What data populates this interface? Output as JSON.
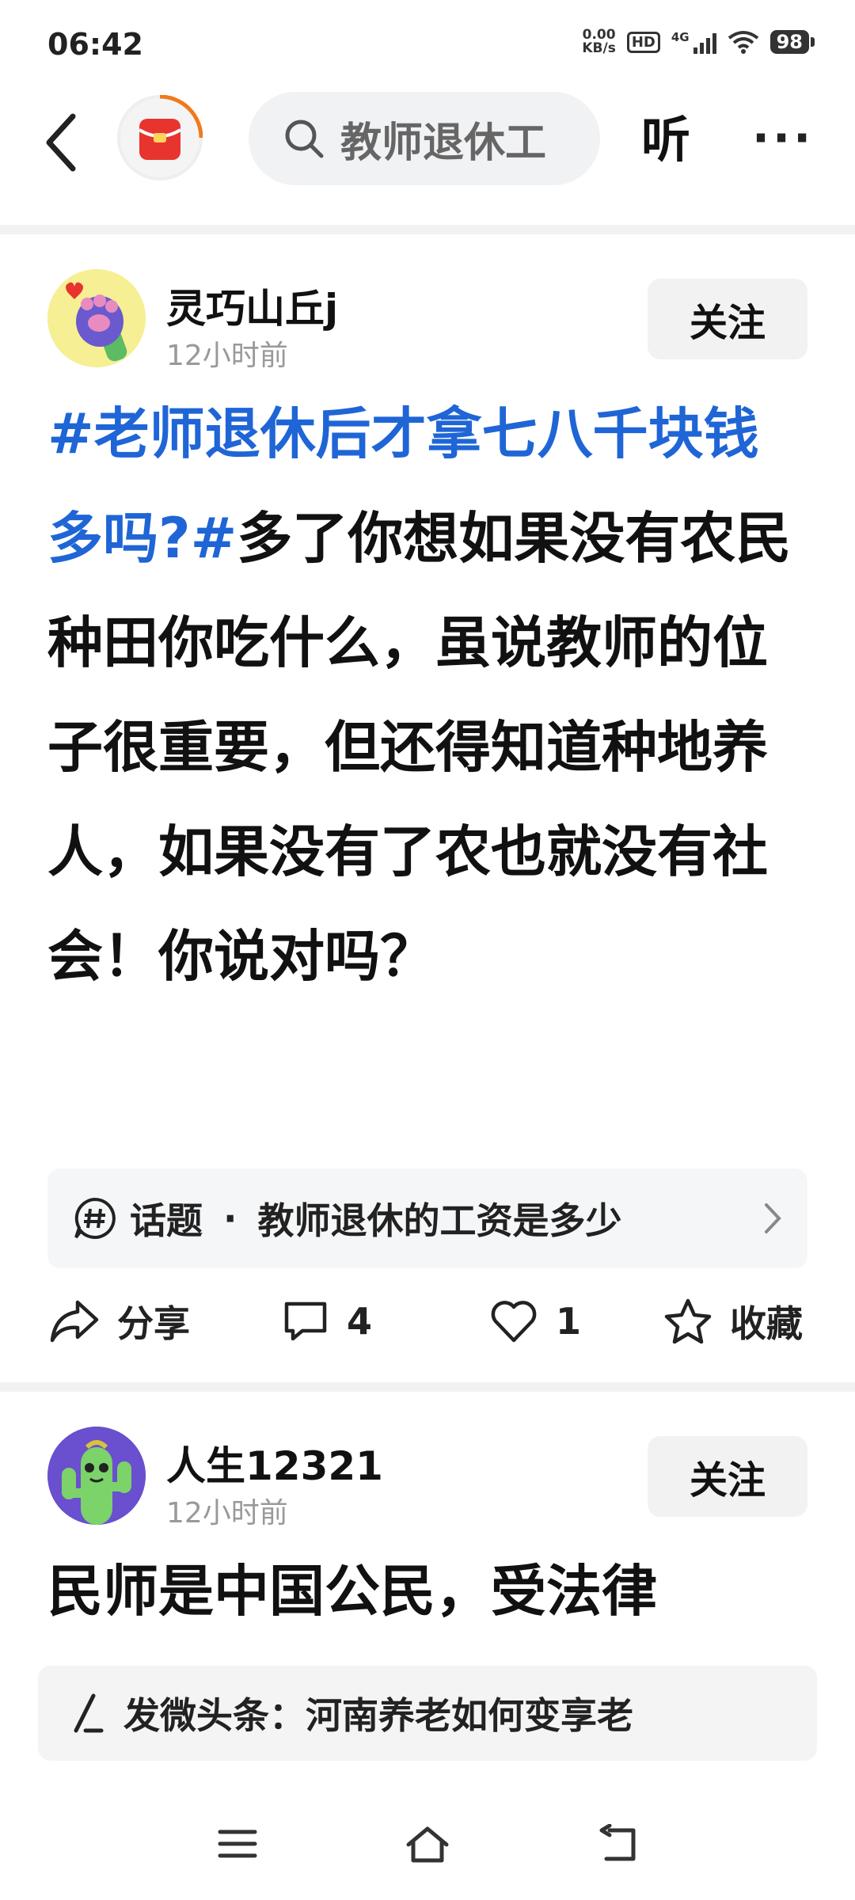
{
  "status_bar": {
    "time": "06:42",
    "net_speed_value": "0.00",
    "net_speed_unit": "KB/s",
    "hd": "HD",
    "network": "4G",
    "battery": "98"
  },
  "header": {
    "search_text": "教师退休工",
    "listen_label": "听",
    "more_label": "···"
  },
  "posts": [
    {
      "username": "灵巧山丘j",
      "time": "12小时前",
      "follow_label": "关注",
      "tag": "#老师退休后才拿七八千块钱多吗?#",
      "body": "多了你想如果没有农民种田你吃什么，虽说教师的位子很重要，但还得知道种地养人，如果没有了农也就没有社会！你说对吗？",
      "topic": {
        "label": "话题",
        "separator": "·",
        "text": "教师退休的工资是多少"
      },
      "actions": {
        "share": "分享",
        "comments": "4",
        "likes": "1",
        "favorite": "收藏"
      }
    },
    {
      "username": "人生12321",
      "time": "12小时前",
      "follow_label": "关注",
      "body": "民师是中国公民，受法律"
    }
  ],
  "publish_bar": {
    "text": "发微头条：河南养老如何变享老"
  },
  "colors": {
    "accent_blue": "#1f65d6",
    "redpacket_red": "#e8342f",
    "progress_orange": "#f07a1b"
  }
}
